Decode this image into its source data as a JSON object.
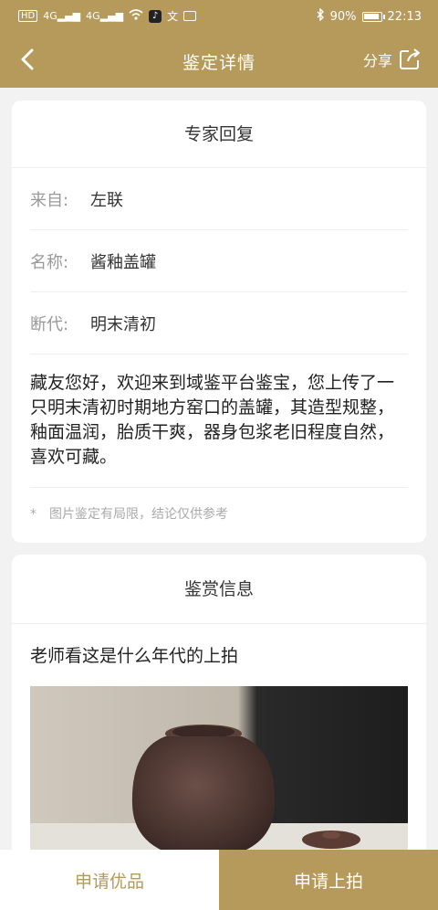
{
  "status_bar": {
    "left_icons": [
      "hd-icon",
      "signal-icon",
      "signal-icon",
      "wifi-icon",
      "tiktok-icon",
      "translate-icon",
      "image-icon"
    ],
    "signal_label": "4G",
    "battery": "90%",
    "time": "22:13"
  },
  "navbar": {
    "title": "鉴定详情",
    "share_label": "分享"
  },
  "expert_card": {
    "title": "专家回复",
    "rows": [
      {
        "label": "来自:",
        "value": "左联"
      },
      {
        "label": "名称:",
        "value": "酱釉盖罐"
      },
      {
        "label": "断代:",
        "value": "明末清初"
      }
    ],
    "description": "藏友您好，欢迎来到域鉴平台鉴宝，您上传了一只明末清初时期地方窑口的盖罐，其造型规整，釉面温润，胎质干爽，器身包浆老旧程度自然，喜欢可藏。",
    "note_star": "*",
    "note": "图片鉴定有局限，结论仅供参考"
  },
  "appreciation_card": {
    "title": "鉴赏信息",
    "question": "老师看这是什么年代的上拍"
  },
  "bottom_bar": {
    "left_label": "申请优品",
    "right_label": "申请上拍"
  },
  "colors": {
    "brand_gold": "#b59a5b",
    "background": "#f2f2f2"
  }
}
